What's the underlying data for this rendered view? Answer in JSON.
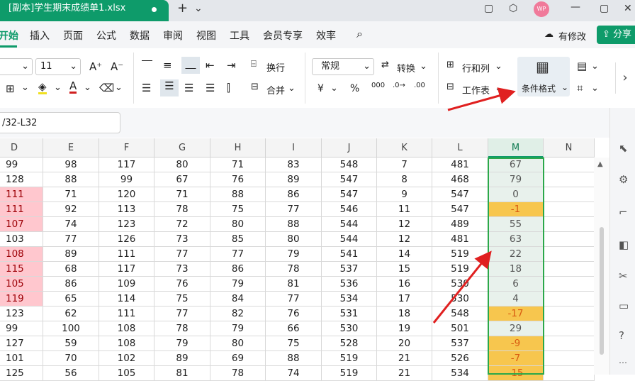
{
  "titlebar": {
    "doc_tab": "[副本]学生期末成绩单1.xlsx",
    "new_tab": "+",
    "tab_menu": "⌄",
    "avatar": "WP",
    "icons": [
      "window-icon",
      "cube-icon",
      "avatar",
      "minimize-icon",
      "maximize-icon",
      "close-icon"
    ]
  },
  "menubar": {
    "items": [
      "开始",
      "插入",
      "页面",
      "公式",
      "数据",
      "审阅",
      "视图",
      "工具",
      "会员专享",
      "效率"
    ],
    "has_changes": "有修改",
    "share": "分享"
  },
  "ribbon": {
    "font_size": "11",
    "wrap": "换行",
    "merge": "合并",
    "number_format": "常规",
    "convert": "转换",
    "rows_cols": "行和列",
    "worksheet": "工作表",
    "conditional_format": "条件格式",
    "currency": "¥",
    "percent": "%"
  },
  "formula_bar": {
    "name_box": "/32-L32"
  },
  "sheet": {
    "columns": [
      "D",
      "E",
      "F",
      "G",
      "H",
      "I",
      "J",
      "K",
      "L",
      "M",
      "N"
    ],
    "rows": [
      [
        "99",
        "98",
        "117",
        "80",
        "71",
        "83",
        "548",
        "7",
        "481",
        "67"
      ],
      [
        "128",
        "88",
        "99",
        "67",
        "76",
        "89",
        "547",
        "8",
        "468",
        "79"
      ],
      [
        "111",
        "71",
        "120",
        "71",
        "88",
        "86",
        "547",
        "9",
        "547",
        "0"
      ],
      [
        "111",
        "92",
        "113",
        "78",
        "75",
        "77",
        "546",
        "11",
        "547",
        "-1"
      ],
      [
        "107",
        "74",
        "123",
        "72",
        "80",
        "88",
        "544",
        "12",
        "489",
        "55"
      ],
      [
        "103",
        "77",
        "126",
        "73",
        "85",
        "80",
        "544",
        "12",
        "481",
        "63"
      ],
      [
        "108",
        "89",
        "111",
        "77",
        "77",
        "79",
        "541",
        "14",
        "519",
        "22"
      ],
      [
        "115",
        "68",
        "117",
        "73",
        "86",
        "78",
        "537",
        "15",
        "519",
        "18"
      ],
      [
        "105",
        "86",
        "109",
        "76",
        "79",
        "81",
        "536",
        "16",
        "530",
        "6"
      ],
      [
        "119",
        "65",
        "114",
        "75",
        "84",
        "77",
        "534",
        "17",
        "530",
        "4"
      ],
      [
        "123",
        "62",
        "111",
        "77",
        "82",
        "76",
        "531",
        "18",
        "548",
        "-17"
      ],
      [
        "99",
        "100",
        "108",
        "78",
        "79",
        "66",
        "530",
        "19",
        "501",
        "29"
      ],
      [
        "127",
        "59",
        "108",
        "79",
        "80",
        "75",
        "528",
        "20",
        "537",
        "-9"
      ],
      [
        "101",
        "70",
        "102",
        "89",
        "69",
        "88",
        "519",
        "21",
        "526",
        "-7"
      ],
      [
        "125",
        "56",
        "105",
        "81",
        "78",
        "74",
        "519",
        "21",
        "534",
        "-15"
      ]
    ],
    "highlight_d_rows": [
      2,
      3,
      4,
      6,
      7,
      8,
      9
    ],
    "colors": {
      "pink_fill": "#ffc7ce",
      "negative_fill": "#f7c64e",
      "neutral_fill": "#e8f1ec",
      "accent": "#0e9b6a",
      "arrow": "#e02020"
    }
  }
}
